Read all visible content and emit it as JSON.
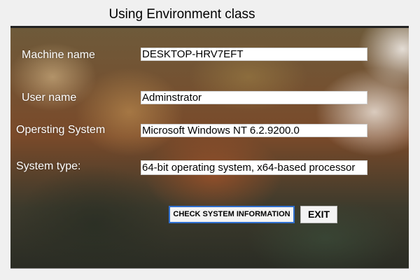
{
  "window": {
    "title": "Using Environment class"
  },
  "fields": {
    "machine_name": {
      "label": "Machine name",
      "value": "DESKTOP-HRV7EFT"
    },
    "user_name": {
      "label": "User name",
      "value": "Adminstrator"
    },
    "os": {
      "label": "Opersting System",
      "value": "Microsoft Windows NT 6.2.9200.0"
    },
    "system_type": {
      "label": "System type:",
      "value": "64-bit operating system, x64-based processor"
    }
  },
  "buttons": {
    "check": "CHECK SYSTEM INFORMATION",
    "exit": "EXIT"
  },
  "colors": {
    "window_bg": "#f0f0f0",
    "label_text": "#ffffff",
    "check_button_border": "#2f6fcf"
  }
}
